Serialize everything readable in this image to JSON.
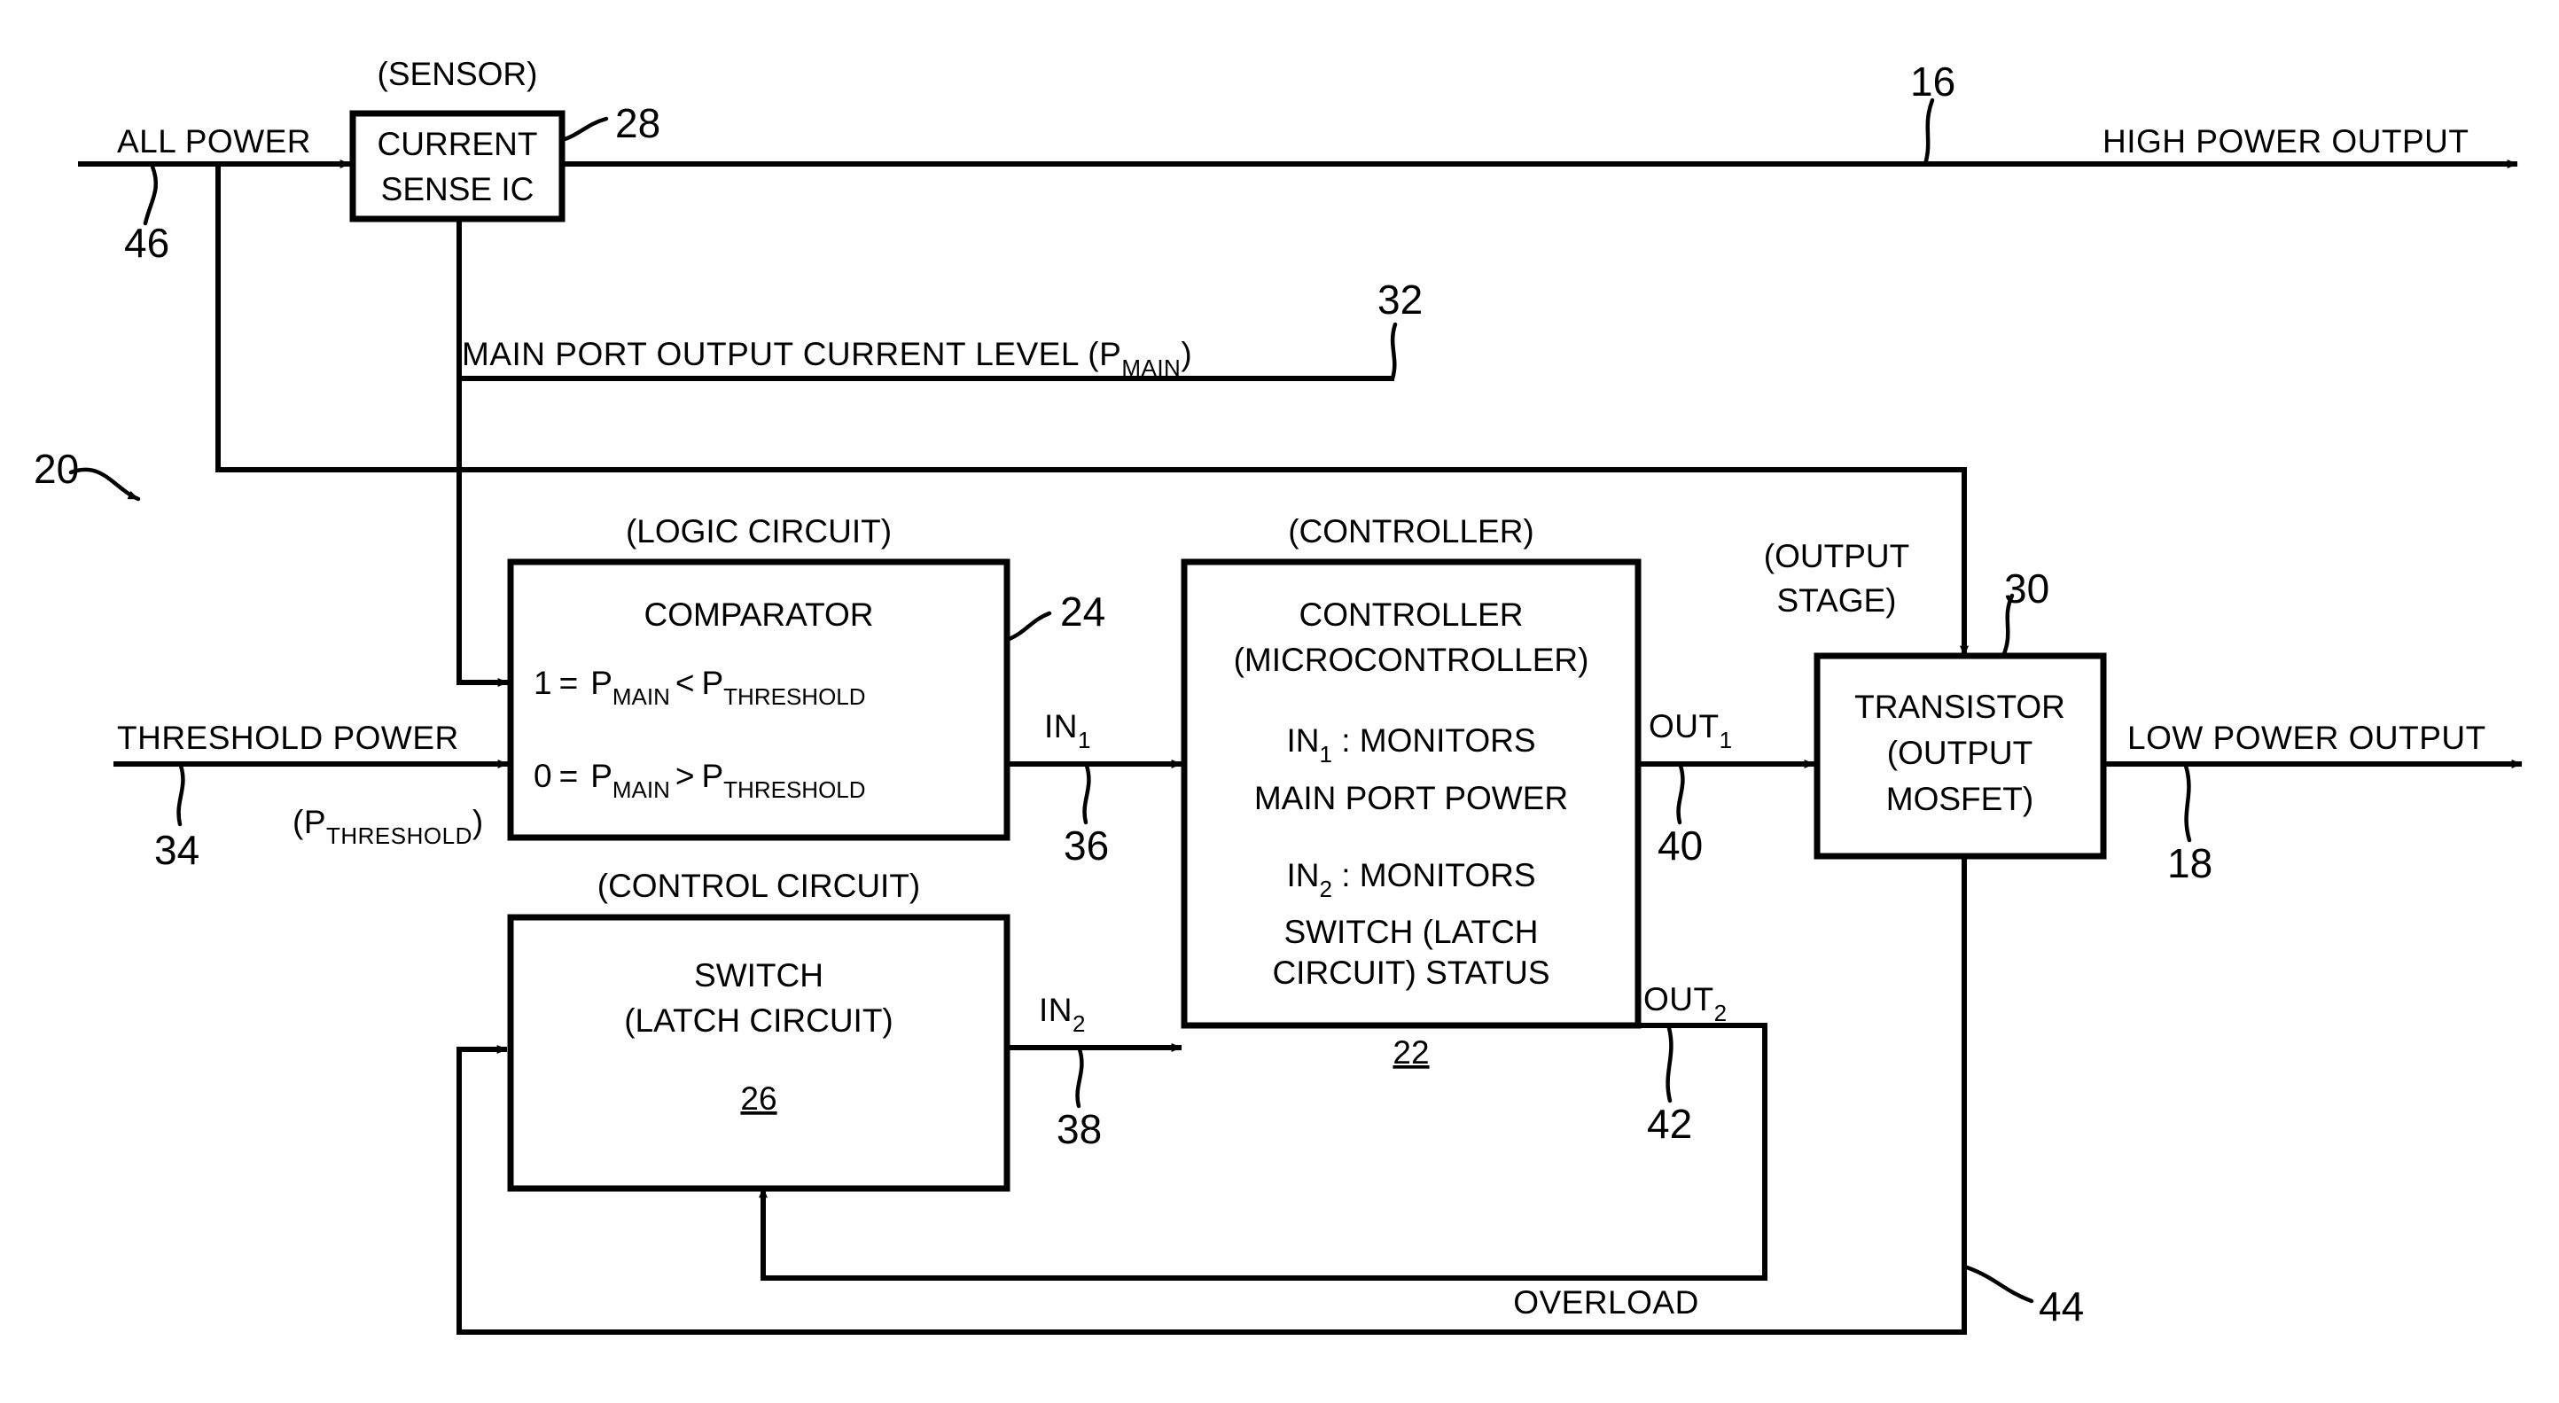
{
  "figure": {
    "title": "Power distribution control block diagram",
    "line_color": "#000000",
    "background": "#ffffff"
  },
  "signals": {
    "all_power": "ALL POWER",
    "high_power_output": "HIGH POWER OUTPUT",
    "low_power_output": "LOW POWER OUTPUT",
    "threshold_power": "THRESHOLD POWER",
    "threshold_power_sym_open": "(P",
    "threshold_power_sym_sub": "THRESHOLD",
    "threshold_power_sym_close": ")",
    "main_port_level": "MAIN PORT OUTPUT CURRENT LEVEL (P",
    "main_port_level_sub": "MAIN",
    "main_port_level_close": ")",
    "overload": "OVERLOAD",
    "in1": "IN",
    "in1_sub": "1",
    "in2": "IN",
    "in2_sub": "2",
    "out1": "OUT",
    "out1_sub": "1",
    "out2": "OUT",
    "out2_sub": "2"
  },
  "group_labels": {
    "sensor": "(SENSOR)",
    "logic_circuit": "(LOGIC CIRCUIT)",
    "controller": "(CONTROLLER)",
    "control_circuit": "(CONTROL CIRCUIT)",
    "output_stage_line1": "(OUTPUT",
    "output_stage_line2": "STAGE)"
  },
  "blocks": {
    "current_sense_ic": {
      "line1": "CURRENT",
      "line2": "SENSE IC",
      "ref": "28"
    },
    "comparator": {
      "title": "COMPARATOR",
      "rule1_prefix": "1",
      "rule1_eq": "=",
      "rule1_p1": "P",
      "rule1_p1_sub": "MAIN",
      "rule1_op": "<",
      "rule1_p2": "P",
      "rule1_p2_sub": "THRESHOLD",
      "rule2_prefix": "0",
      "rule2_eq": "=",
      "rule2_p1": "P",
      "rule2_p1_sub": "MAIN",
      "rule2_op": ">",
      "rule2_p2": "P",
      "rule2_p2_sub": "THRESHOLD",
      "ref": "24"
    },
    "controller": {
      "line1": "CONTROLLER",
      "line2": "(MICROCONTROLLER)",
      "in1_label": "IN",
      "in1_sub": "1",
      "in1_text": " : MONITORS",
      "in1_desc": "MAIN PORT POWER",
      "in2_label": "IN",
      "in2_sub": "2",
      "in2_text": " : MONITORS",
      "in2_desc_line1": "SWITCH (LATCH",
      "in2_desc_line2": "CIRCUIT) STATUS",
      "ref": "22"
    },
    "switch": {
      "line1": "SWITCH",
      "line2": "(LATCH CIRCUIT)",
      "ref": "26"
    },
    "transistor": {
      "line1": "TRANSISTOR",
      "line2": "(OUTPUT",
      "line3": "MOSFET)",
      "ref": "30"
    }
  },
  "reference_numerals": {
    "system": "20",
    "high_power_line": "16",
    "low_power_line": "18",
    "controller": "22",
    "comparator": "24",
    "switch": "26",
    "current_sense_ic": "28",
    "transistor": "30",
    "main_port_level_line": "32",
    "threshold_line": "34",
    "in1_line": "36",
    "in2_line": "38",
    "out1_line": "40",
    "out2_line": "42",
    "overload_line": "44",
    "all_power_line": "46"
  }
}
